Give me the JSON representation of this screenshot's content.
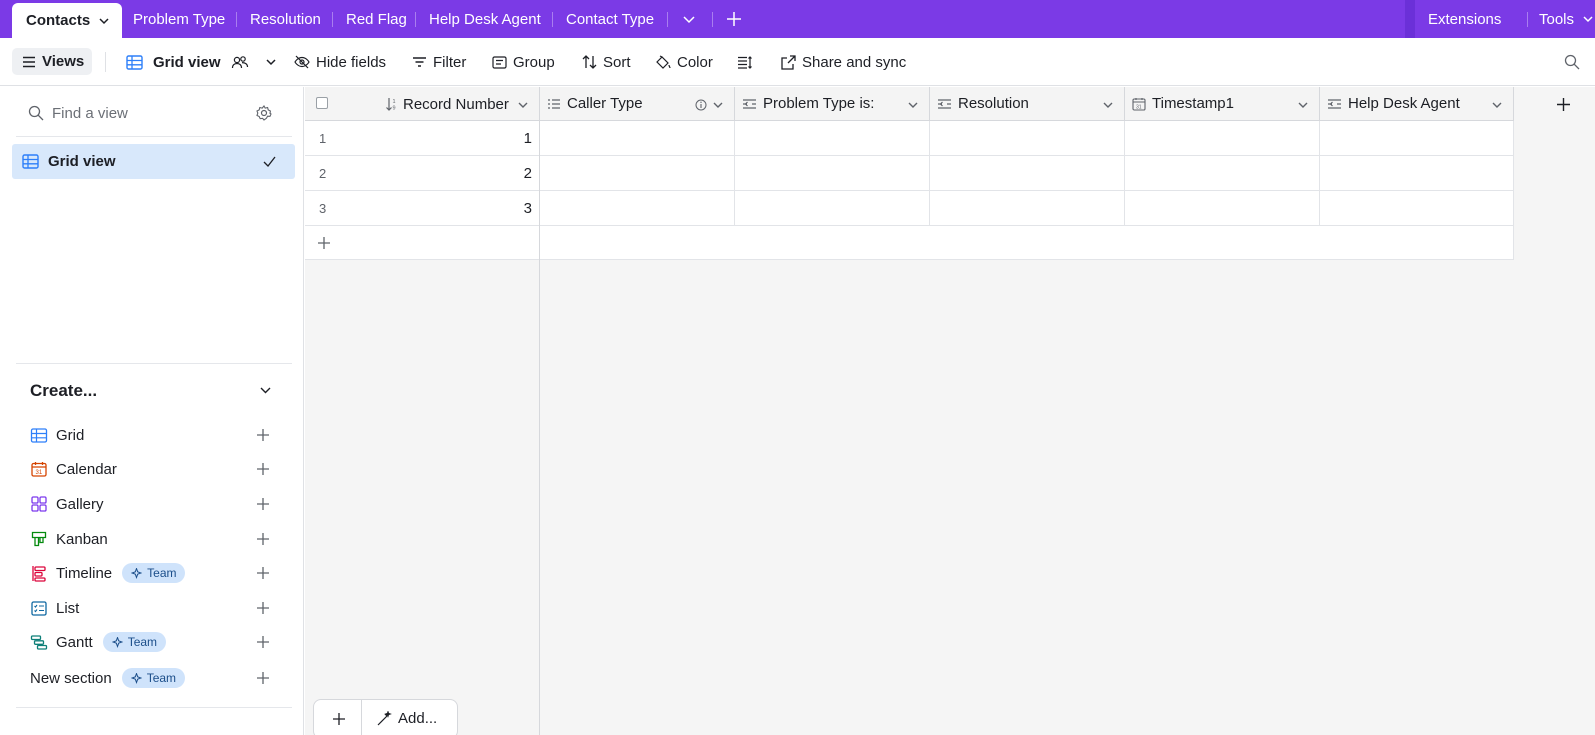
{
  "topbar": {
    "active_tab": "Contacts",
    "tabs": [
      "Problem Type",
      "Resolution",
      "Red Flag",
      "Help Desk Agent",
      "Contact Type"
    ],
    "extensions": "Extensions",
    "tools": "Tools"
  },
  "toolbar": {
    "views": "Views",
    "view_name": "Grid view",
    "hide_fields": "Hide fields",
    "filter": "Filter",
    "group": "Group",
    "sort": "Sort",
    "color": "Color",
    "share": "Share and sync"
  },
  "sidebar": {
    "find_placeholder": "Find a view",
    "current_view": "Grid view",
    "create_title": "Create...",
    "create_items": [
      "Grid",
      "Calendar",
      "Gallery",
      "Kanban",
      "Timeline",
      "List",
      "Gantt",
      "New section"
    ],
    "team_badge": "Team"
  },
  "grid": {
    "columns": [
      "Record Number",
      "Caller Type",
      "Problem Type is:",
      "Resolution",
      "Timestamp1",
      "Help Desk Agent"
    ],
    "rows": [
      {
        "num": "1",
        "record": "1"
      },
      {
        "num": "2",
        "record": "2"
      },
      {
        "num": "3",
        "record": "3"
      }
    ],
    "add_label": "Add..."
  },
  "colors": {
    "brand_purple": "#7b3ae6",
    "selected_view_bg": "#d8e8fb",
    "team_badge_bg": "#cfe3fb"
  }
}
